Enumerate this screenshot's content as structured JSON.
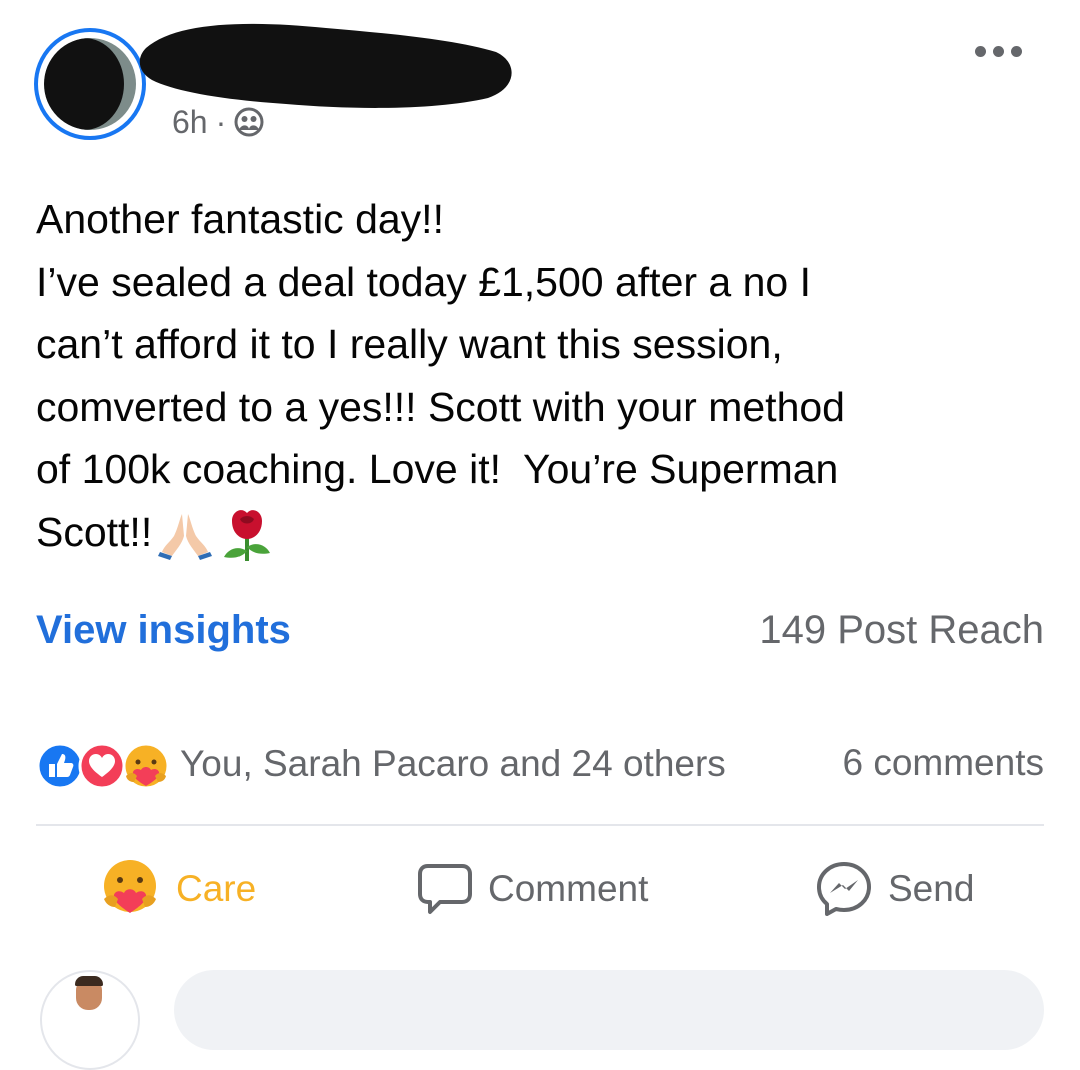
{
  "post": {
    "author": {
      "name_redacted": true
    },
    "timestamp": "6h",
    "separator": "·",
    "audience_icon": "friends-icon",
    "more_icon": "more-horizontal-icon",
    "text_lines": [
      "Another fantastic day!!",
      "I’ve sealed a deal today £1,500 after a no I",
      "can’t afford it to I really want this session,",
      "comverted to a yes!!! Scott with your method",
      "of 100k coaching. Love it!  You’re Superman",
      "Scott!!"
    ],
    "emojis": [
      "folded-hands-emoji",
      "rose-emoji"
    ]
  },
  "insights": {
    "link_label": "View insights",
    "reach_label": "149 Post Reach"
  },
  "engagement": {
    "reaction_icons": [
      "like-icon",
      "love-icon",
      "care-icon"
    ],
    "reactions_text": "You, Sarah Pacaro and 24 others",
    "comments_text": "6 comments"
  },
  "actions": {
    "care_label": "Care",
    "comment_label": "Comment",
    "send_label": "Send"
  },
  "colors": {
    "brand_blue": "#1877f2",
    "link_blue": "#216fdb",
    "secondary_text": "#65676b",
    "care_yellow": "#f7b125",
    "love_red": "#f33e58",
    "divider": "#e4e6eb"
  }
}
